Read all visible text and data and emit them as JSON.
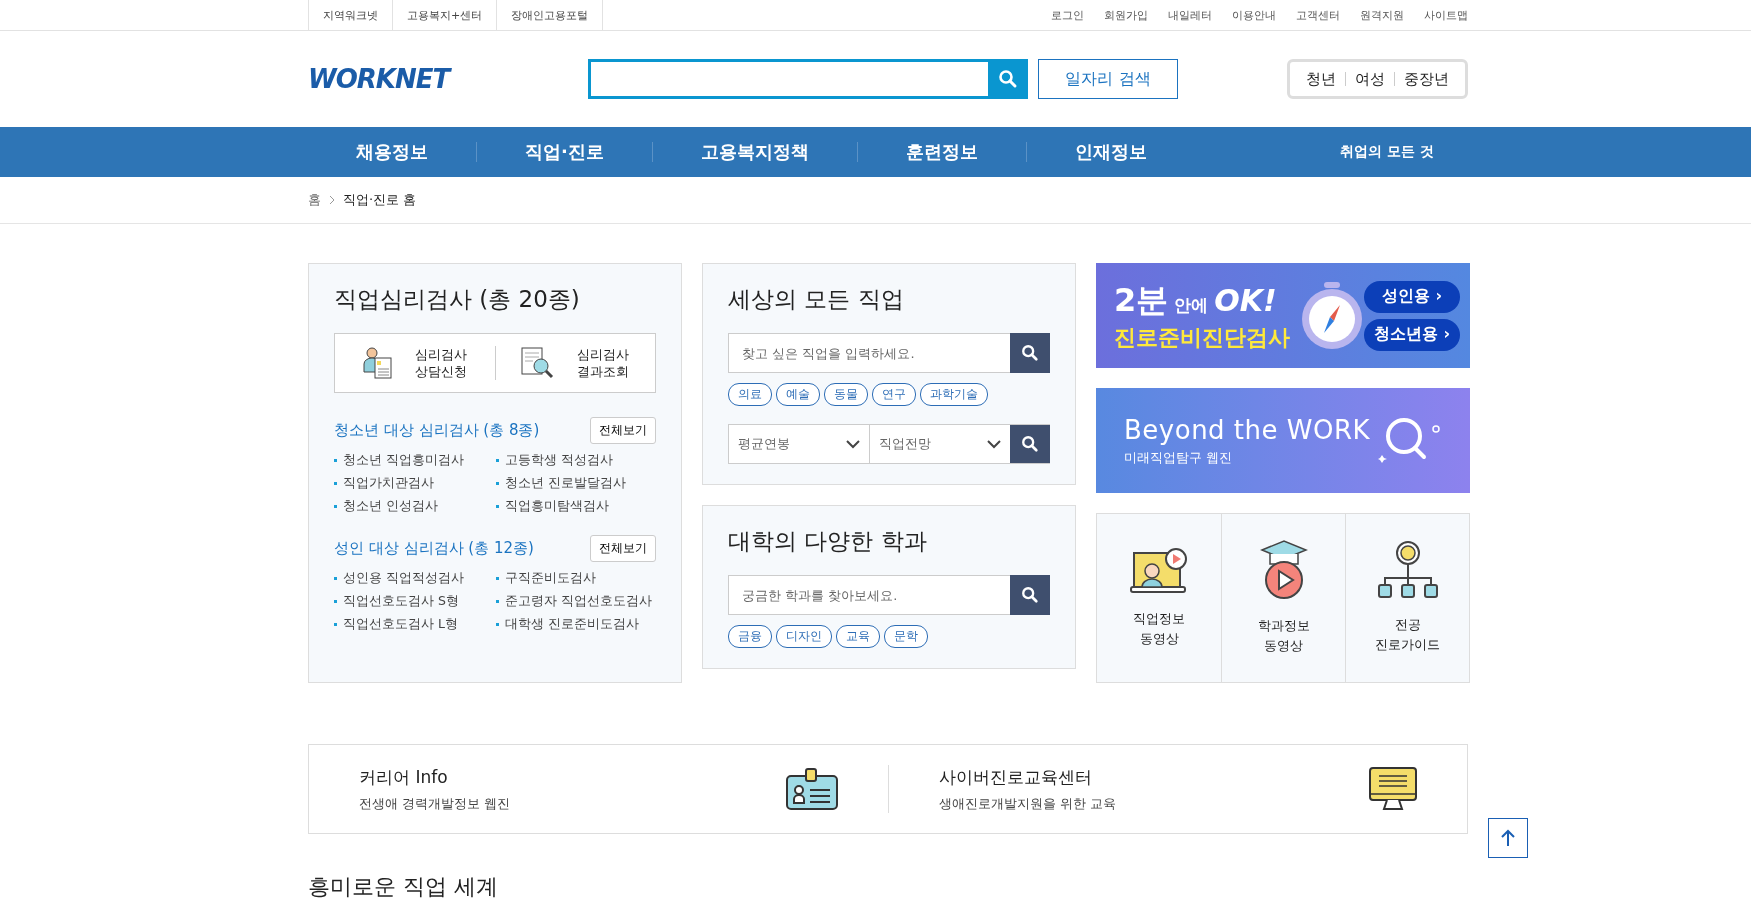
{
  "top_bar": {
    "left_links": [
      "지역워크넷",
      "고용복지+센터",
      "장애인고용포털"
    ],
    "right_links": [
      "로그인",
      "회원가입",
      "내일레터",
      "이용안내",
      "고객센터",
      "원격지원",
      "사이트맵"
    ]
  },
  "header": {
    "logo": "WORKNET",
    "search_button": "일자리 검색",
    "audience_links": [
      "청년",
      "여성",
      "중장년"
    ]
  },
  "nav": {
    "items": [
      "채용정보",
      "직업·진로",
      "고용복지정책",
      "훈련정보",
      "인재정보"
    ],
    "extra": "취업의 모든 것"
  },
  "breadcrumb": [
    "홈",
    "직업·진로 홈"
  ],
  "test_card": {
    "title": "직업심리검사 (총 20종)",
    "actions": [
      {
        "kind": "apply",
        "lines": [
          "심리검사",
          "상담신청"
        ]
      },
      {
        "kind": "result",
        "lines": [
          "심리검사",
          "결과조회"
        ]
      }
    ],
    "groups": [
      {
        "title": "청소년 대상 심리검사 (총 8종)",
        "button": "전체보기",
        "items": [
          "청소년 직업흥미검사",
          "고등학생 적성검사",
          "직업가치관검사",
          "청소년 진로발달검사",
          "청소년 인성검사",
          "직업흥미탐색검사"
        ]
      },
      {
        "title": "성인 대상 심리검사 (총 12종)",
        "button": "전체보기",
        "items": [
          "성인용 직업적성검사",
          "구직준비도검사",
          "직업선호도검사 S형",
          "준고령자 직업선호도검사",
          "직업선호도검사 L형",
          "대학생 진로준비도검사"
        ]
      }
    ]
  },
  "jobs_card": {
    "title": "세상의 모든 직업",
    "placeholder": "찾고 싶은 직업을 입력하세요.",
    "tags": [
      "의료",
      "예술",
      "동물",
      "연구",
      "과학기술"
    ],
    "selects": [
      "평균연봉",
      "직업전망"
    ]
  },
  "majors_card": {
    "title": "대학의 다양한 학과",
    "placeholder": "궁금한 학과를 찾아보세요.",
    "tags": [
      "금융",
      "디자인",
      "교육",
      "문학"
    ]
  },
  "banner_test": {
    "headline_big": "2분",
    "headline_small": "안에",
    "headline_ok": "OK!",
    "subtitle": "진로준비진단검사",
    "buttons": [
      "성인용 ›",
      "청소년용 ›"
    ]
  },
  "banner_webzine": {
    "title": "Beyond the WORK",
    "subtitle": "미래직업탐구 웹진"
  },
  "quick_links": [
    {
      "kind": "video",
      "lines": [
        "직업정보",
        "동영상"
      ]
    },
    {
      "kind": "grad",
      "lines": [
        "학과정보",
        "동영상"
      ]
    },
    {
      "kind": "tree",
      "lines": [
        "전공",
        "진로가이드"
      ]
    }
  ],
  "info_strip": [
    {
      "kind": "badge",
      "title": "커리어 Info",
      "subtitle": "전생애 경력개발정보 웹진"
    },
    {
      "kind": "monitor",
      "title": "사이버진로교육센터",
      "subtitle": "생애진로개발지원을 위한 교육"
    }
  ],
  "section_title": "흥미로운 직업 세계"
}
